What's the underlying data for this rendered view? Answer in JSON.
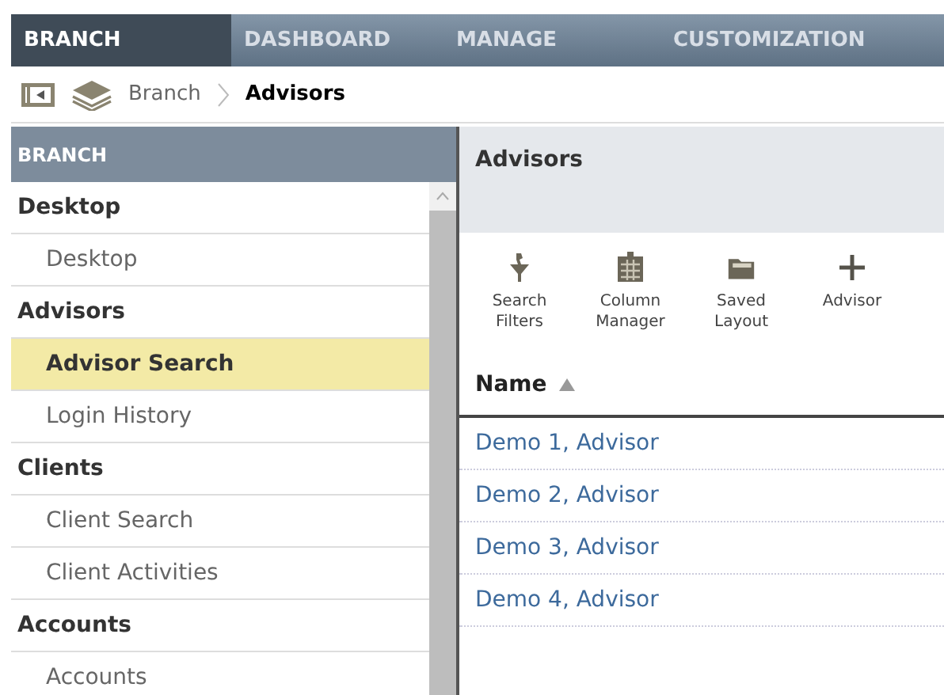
{
  "nav_tabs": [
    {
      "label": "BRANCH",
      "selected": true
    },
    {
      "label": "DASHBOARD",
      "selected": false
    },
    {
      "label": "MANAGE",
      "selected": false
    },
    {
      "label": "CUSTOMIZATION",
      "selected": false
    }
  ],
  "breadcrumb": [
    "Branch",
    "Advisors"
  ],
  "sidebar": {
    "title": "BRANCH",
    "items": [
      {
        "kind": "group",
        "label": "Desktop"
      },
      {
        "kind": "item",
        "label": "Desktop",
        "selected": false
      },
      {
        "kind": "group",
        "label": "Advisors"
      },
      {
        "kind": "item",
        "label": "Advisor Search",
        "selected": true
      },
      {
        "kind": "item",
        "label": "Login History",
        "selected": false
      },
      {
        "kind": "group",
        "label": "Clients"
      },
      {
        "kind": "item",
        "label": "Client Search",
        "selected": false
      },
      {
        "kind": "item",
        "label": "Client Activities",
        "selected": false
      },
      {
        "kind": "group",
        "label": "Accounts"
      },
      {
        "kind": "item",
        "label": "Accounts",
        "selected": false
      }
    ]
  },
  "main": {
    "title": "Advisors",
    "toolbar": [
      {
        "label": "Search Filters"
      },
      {
        "label": "Column Manager"
      },
      {
        "label": "Saved Layout"
      },
      {
        "label": "Advisor"
      }
    ],
    "table": {
      "column": "Name",
      "sort_ascending": true,
      "rows": [
        "Demo 1, Advisor",
        "Demo 2, Advisor",
        "Demo 3, Advisor",
        "Demo 4, Advisor"
      ]
    }
  }
}
